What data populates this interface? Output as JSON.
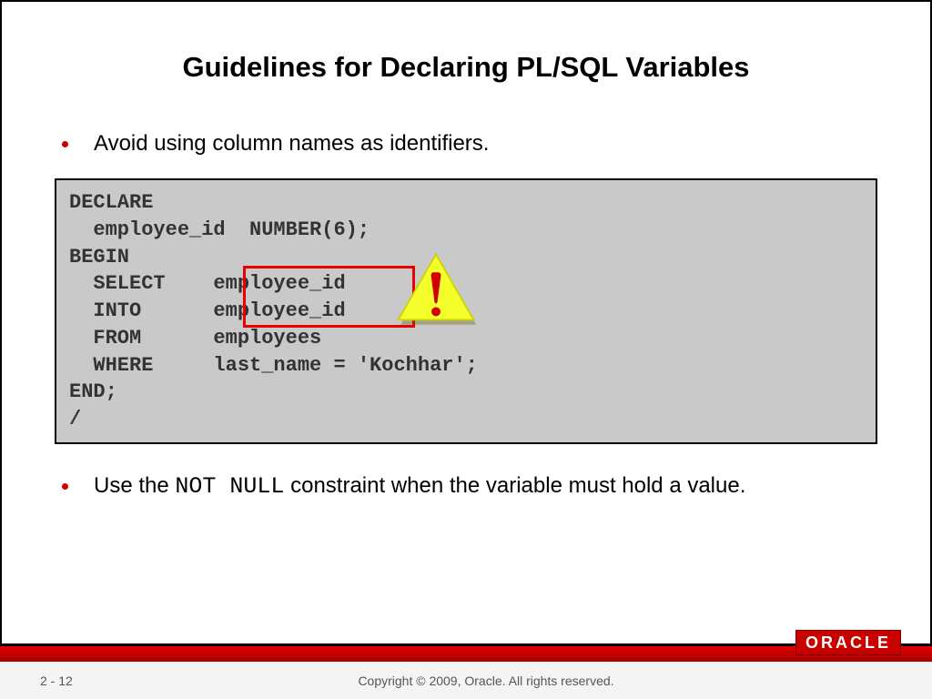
{
  "title": "Guidelines for Declaring PL/SQL Variables",
  "bullets": {
    "b1": "Avoid using column names as identifiers.",
    "b2_pre": "Use the ",
    "b2_code": "NOT NULL",
    "b2_post": " constraint when the variable must hold a value."
  },
  "code": {
    "l1": "DECLARE",
    "l2": "  employee_id  NUMBER(6);",
    "l3": "BEGIN",
    "l4": "  SELECT    employee_id",
    "l5": "  INTO      employee_id",
    "l6": "  FROM      employees",
    "l7": "  WHERE     last_name = 'Kochhar';",
    "l8": "END;",
    "l9": "/"
  },
  "footer": {
    "page": "2 - 12",
    "copyright": "Copyright © 2009, Oracle. All rights reserved."
  },
  "logo": "ORACLE"
}
